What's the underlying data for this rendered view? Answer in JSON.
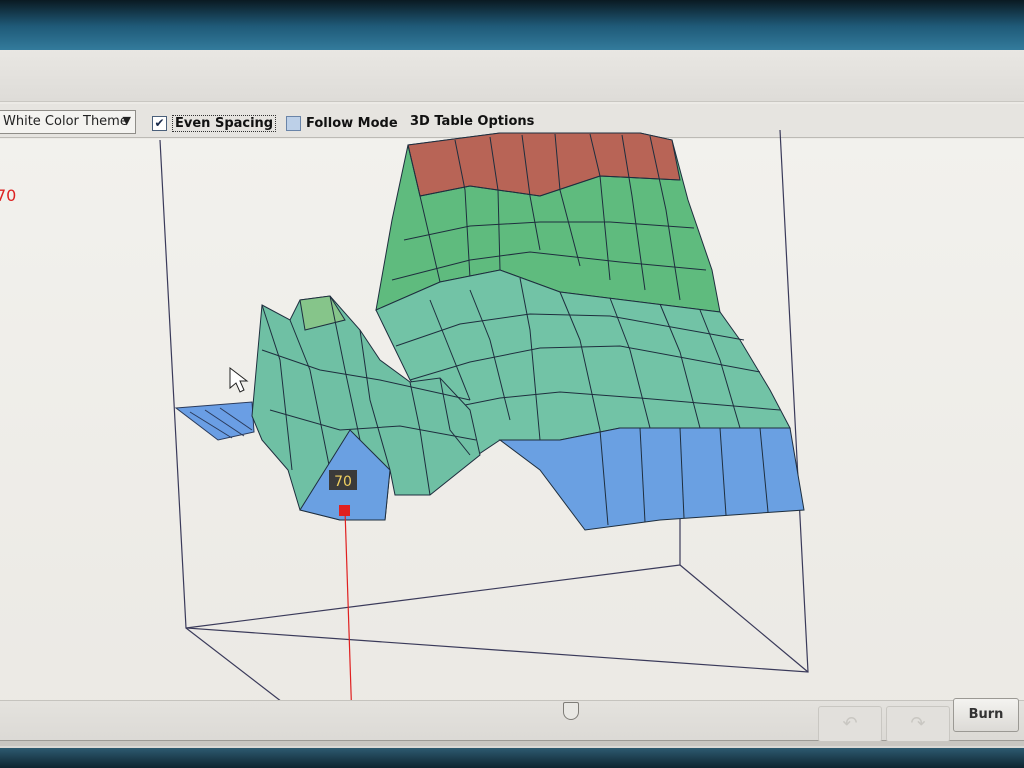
{
  "toolbar": {
    "theme_select": "White Color Theme",
    "even_spacing": {
      "label": "Even Spacing",
      "checked": true
    },
    "follow_mode": {
      "label": "Follow Mode",
      "checked": false
    },
    "table_options": "3D Table Options"
  },
  "side_value": "70",
  "cursor_value": "70",
  "burn_button": "Burn",
  "icons": {
    "undo": "undo-icon",
    "redo": "redo-icon",
    "pointer": "mouse-pointer-icon"
  },
  "colors": {
    "low": "#6b9fe0",
    "mid": "#5fc07e",
    "high": "#c06060",
    "cursor": "#e02020"
  }
}
